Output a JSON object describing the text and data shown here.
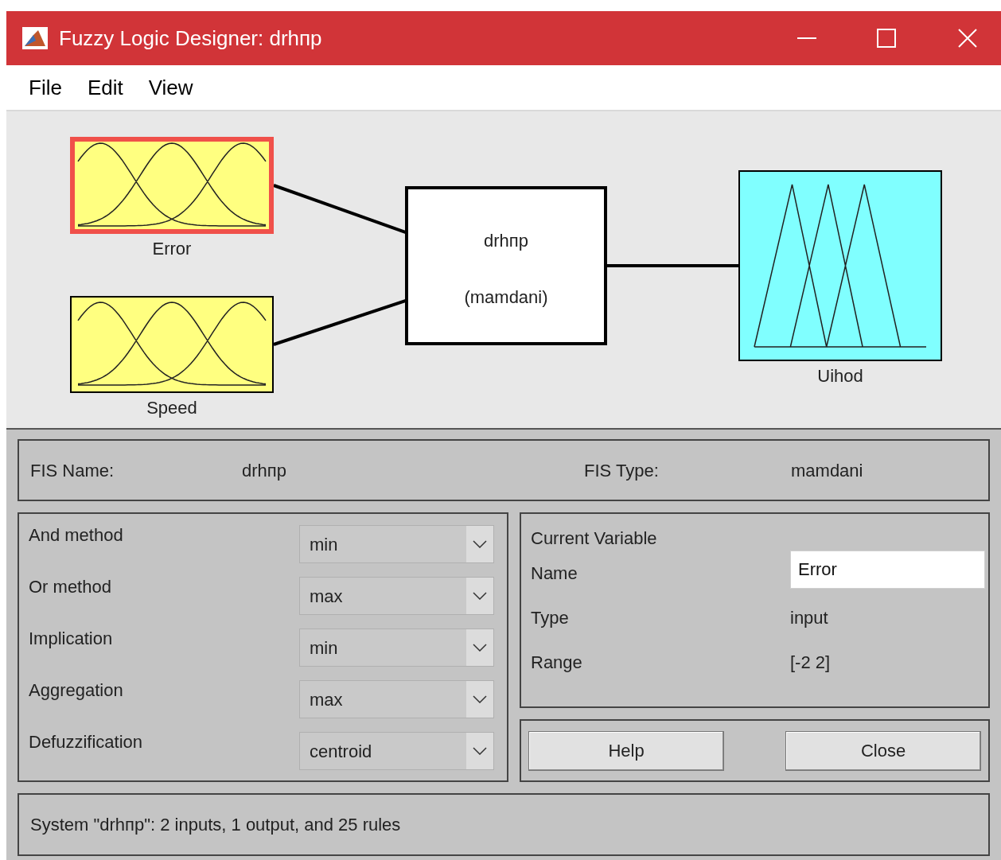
{
  "window": {
    "title": "Fuzzy Logic Designer: drhпp"
  },
  "menu": [
    "File",
    "Edit",
    "View"
  ],
  "diagram": {
    "inputs": [
      {
        "label": "Error",
        "selected": true
      },
      {
        "label": "Speed",
        "selected": false
      }
    ],
    "system": {
      "name": "drhпp",
      "type": "(mamdani)"
    },
    "outputs": [
      {
        "label": "Uihod",
        "selected": false
      }
    ]
  },
  "fis": {
    "name_label": "FIS Name:",
    "name": "drhпp",
    "type_label": "FIS Type:",
    "type": "mamdani"
  },
  "methods": [
    {
      "label": "And method",
      "value": "min"
    },
    {
      "label": "Or method",
      "value": "max"
    },
    {
      "label": "Implication",
      "value": "min"
    },
    {
      "label": "Aggregation",
      "value": "max"
    },
    {
      "label": "Defuzzification",
      "value": "centroid"
    }
  ],
  "current_variable": {
    "title": "Current Variable",
    "fields": [
      {
        "label": "Name",
        "value": "Error",
        "kind": "field"
      },
      {
        "label": "Type",
        "value": "input",
        "kind": "text"
      },
      {
        "label": "Range",
        "value": "[-2 2]",
        "kind": "text"
      }
    ]
  },
  "buttons": [
    "Help",
    "Close"
  ],
  "status": "System \"drhпp\": 2 inputs, 1 output, and 25 rules"
}
